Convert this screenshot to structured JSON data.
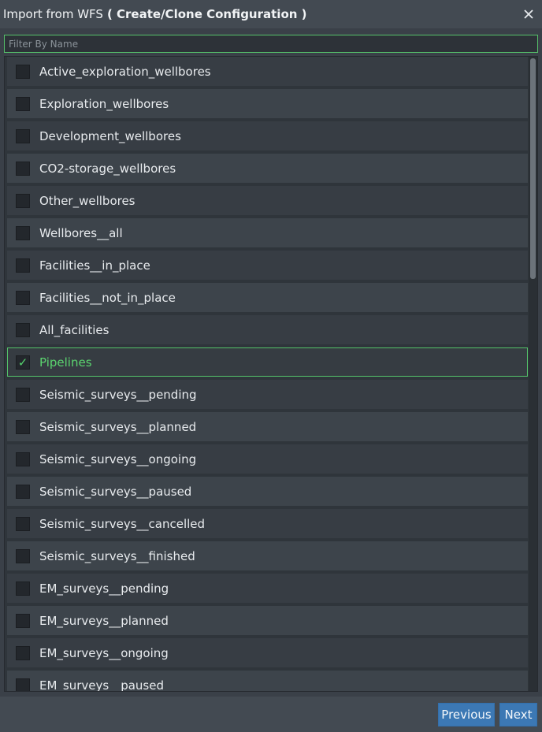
{
  "dialog": {
    "title_main": "Import from WFS",
    "title_sub": "( Create/Clone Configuration )"
  },
  "filter": {
    "placeholder": "Filter By Name",
    "value": ""
  },
  "layers": [
    {
      "label": "Active_exploration_wellbores",
      "checked": false
    },
    {
      "label": "Exploration_wellbores",
      "checked": false
    },
    {
      "label": "Development_wellbores",
      "checked": false
    },
    {
      "label": "CO2-storage_wellbores",
      "checked": false
    },
    {
      "label": "Other_wellbores",
      "checked": false
    },
    {
      "label": "Wellbores__all",
      "checked": false
    },
    {
      "label": "Facilities__in_place",
      "checked": false
    },
    {
      "label": "Facilities__not_in_place",
      "checked": false
    },
    {
      "label": "All_facilities",
      "checked": false
    },
    {
      "label": "Pipelines",
      "checked": true
    },
    {
      "label": "Seismic_surveys__pending",
      "checked": false
    },
    {
      "label": "Seismic_surveys__planned",
      "checked": false
    },
    {
      "label": "Seismic_surveys__ongoing",
      "checked": false
    },
    {
      "label": "Seismic_surveys__paused",
      "checked": false
    },
    {
      "label": "Seismic_surveys__cancelled",
      "checked": false
    },
    {
      "label": "Seismic_surveys__finished",
      "checked": false
    },
    {
      "label": "EM_surveys__pending",
      "checked": false
    },
    {
      "label": "EM_surveys__planned",
      "checked": false
    },
    {
      "label": "EM_surveys__ongoing",
      "checked": false
    },
    {
      "label": "EM_surveys__paused",
      "checked": false
    }
  ],
  "footer": {
    "previous_label": "Previous",
    "next_label": "Next"
  },
  "icons": {
    "close": "close-icon",
    "check": "checkmark-icon"
  },
  "colors": {
    "accent_green": "#56c26a",
    "button_blue": "#3c78b4"
  }
}
